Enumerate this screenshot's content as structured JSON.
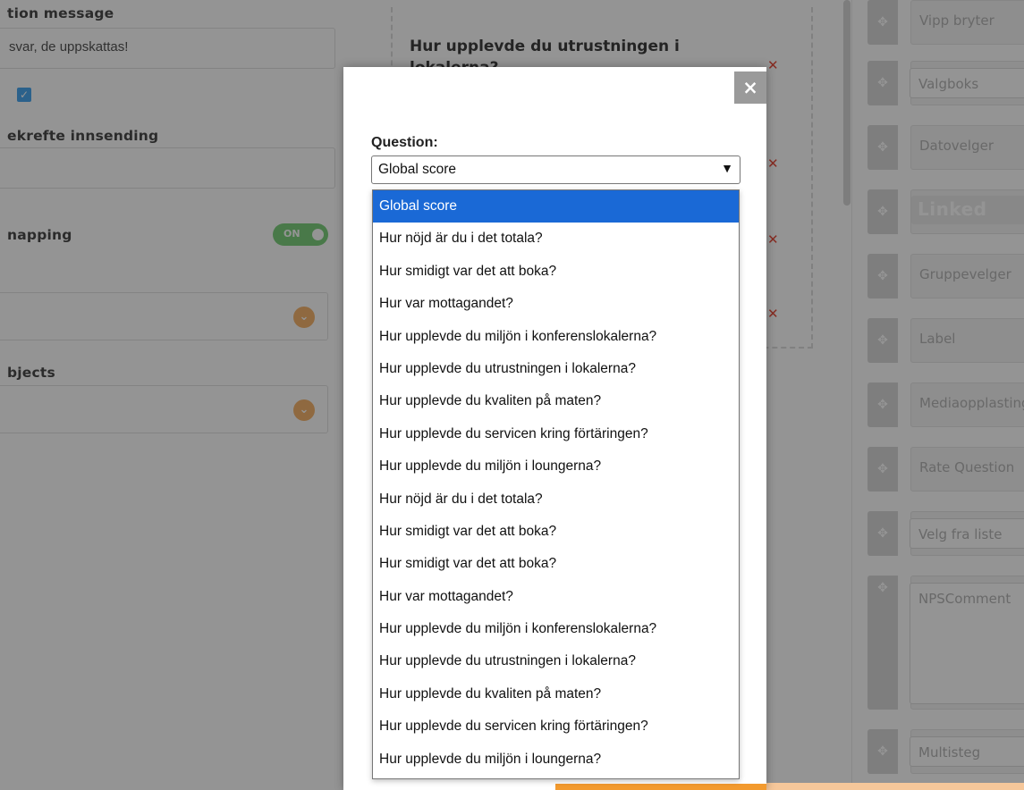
{
  "left": {
    "confirmation_label": "tion message",
    "confirmation_value": "svar, de uppskattas!",
    "confirm_submit_label": "ekrefte innsending",
    "mapping_label": "napping",
    "toggle_label": "ON",
    "objects_label": "bjects"
  },
  "middle": {
    "question_heading": "Hur upplevde du utrustningen i lokalerna?"
  },
  "palette": {
    "items": [
      {
        "label": "Vipp bryter"
      },
      {
        "label": "Valgboks"
      },
      {
        "label": "Datovelger"
      },
      {
        "label": "Linked"
      },
      {
        "label": "Gruppevelger"
      },
      {
        "label": "Label"
      },
      {
        "label": "Mediaopplasting"
      },
      {
        "label": "Rate Question"
      },
      {
        "label": "Velg fra liste"
      },
      {
        "label": "NPSComment"
      },
      {
        "label": "Multisteg"
      }
    ]
  },
  "modal": {
    "close_symbol": "×",
    "question_label": "Question:",
    "selected_value": "Global score"
  },
  "dropdown_options": [
    "Global score",
    "Hur nöjd är du i det totala?",
    "Hur smidigt var det att boka?",
    "Hur var mottagandet?",
    "Hur upplevde du miljön i konferenslokalerna?",
    "Hur upplevde du utrustningen i lokalerna?",
    "Hur upplevde du kvaliten på maten?",
    "Hur upplevde du servicen kring förtäringen?",
    "Hur upplevde du miljön i loungerna?",
    "Hur nöjd är du i det totala?",
    "Hur smidigt var det att boka?",
    "Hur smidigt var det att boka?",
    "Hur var mottagandet?",
    "Hur upplevde du miljön i konferenslokalerna?",
    "Hur upplevde du utrustningen i lokalerna?",
    "Hur upplevde du kvaliten på maten?",
    "Hur upplevde du servicen kring förtäringen?",
    "Hur upplevde du miljön i loungerna?"
  ],
  "colors": {
    "selected_option": "#1a69d6",
    "toggle_on": "#7fd17f",
    "accent_orange": "#f39a2e",
    "close_button": "#9a9a9a"
  }
}
